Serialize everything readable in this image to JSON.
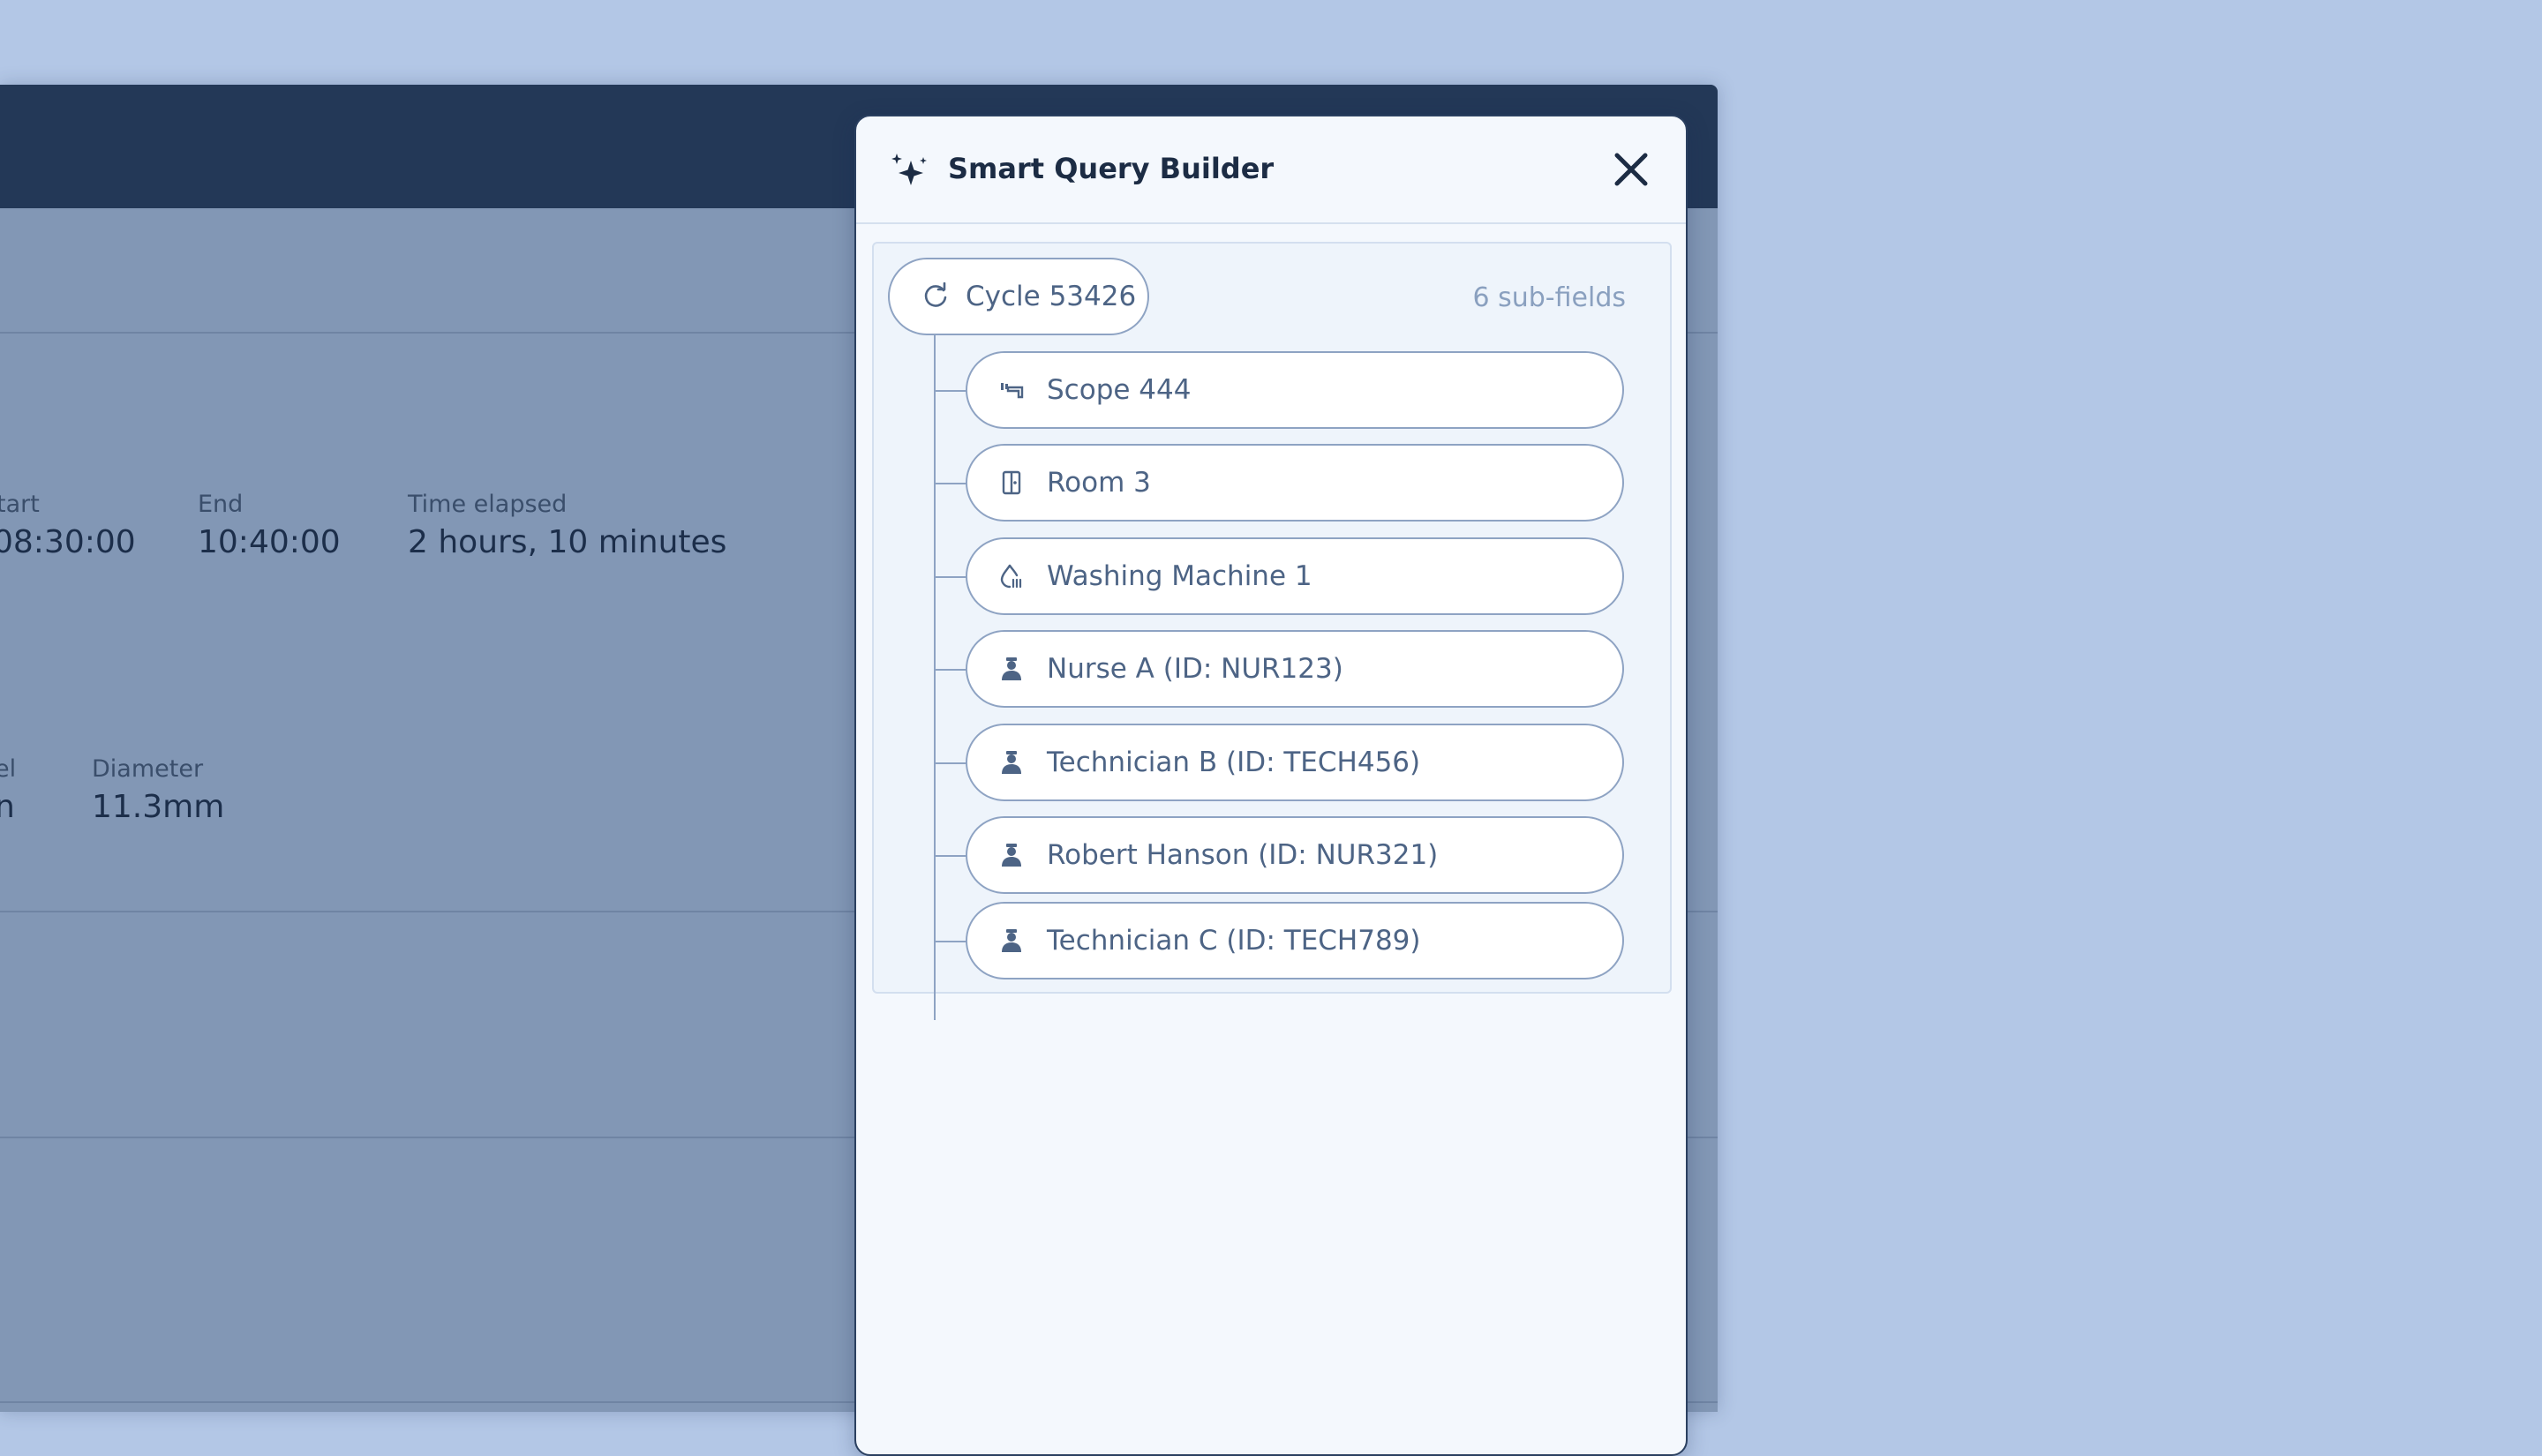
{
  "background_app": {
    "details": [
      {
        "label": "tart",
        "value": "08:30:00"
      },
      {
        "label": "End",
        "value": "10:40:00"
      },
      {
        "label": "Time elapsed",
        "value": "2 hours, 10 minutes"
      }
    ],
    "specs": [
      {
        "label": "el",
        "value": "n"
      },
      {
        "label": "Diameter",
        "value": "11.3mm"
      }
    ]
  },
  "modal": {
    "title": "Smart Query Builder",
    "root": {
      "label": "Cycle 53426",
      "icon": "refresh-icon"
    },
    "sub_count": "6 sub-fields",
    "children": [
      {
        "label": "Scope 444",
        "icon": "scope-icon"
      },
      {
        "label": "Room 3",
        "icon": "door-icon"
      },
      {
        "label": "Washing Machine 1",
        "icon": "washing-machine-icon"
      },
      {
        "label": "Nurse A (ID: NUR123)",
        "icon": "person-icon"
      },
      {
        "label": "Technician B (ID: TECH456)",
        "icon": "person-icon"
      },
      {
        "label": "Robert Hanson (ID: NUR321)",
        "icon": "person-icon"
      },
      {
        "label": "Technician C (ID: TECH789)",
        "icon": "person-icon"
      }
    ]
  },
  "colors": {
    "page_background": "#b3c7e6",
    "app_header": "#233857",
    "overlay_body": "#8297b5",
    "modal_background": "#f4f8fd",
    "pill_border": "#8ea3c3",
    "pill_text": "#4d6485"
  }
}
